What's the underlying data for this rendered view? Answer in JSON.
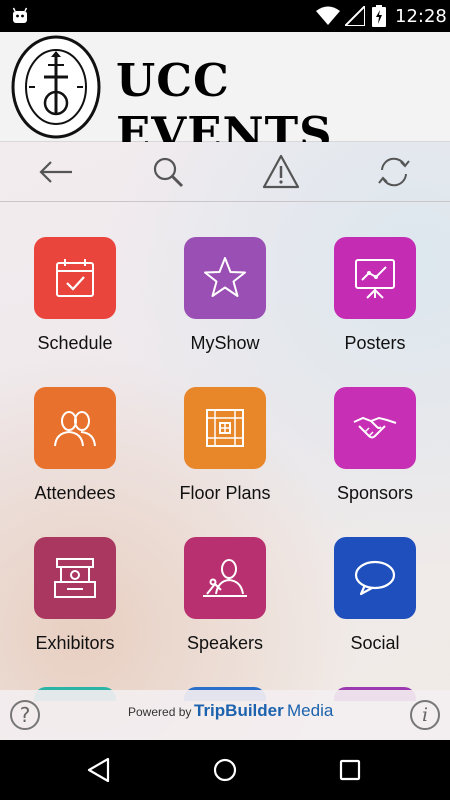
{
  "status_bar": {
    "time": "12:28"
  },
  "header": {
    "title": "UCC EVENTS",
    "logo_text_top": "UNITED CHURCH OF CHRIST",
    "logo_text_bottom": "THAT THEY MAY ALL BE ONE"
  },
  "toolbar": {
    "icons": [
      "back-arrow-icon",
      "search-icon",
      "alert-icon",
      "refresh-icon"
    ]
  },
  "tiles": [
    {
      "label": "Schedule",
      "color": "#e9453c",
      "icon": "calendar-check-icon"
    },
    {
      "label": "MyShow",
      "color": "#9a4fb4",
      "icon": "star-icon"
    },
    {
      "label": "Posters",
      "color": "#c52cb4",
      "icon": "presentation-board-icon"
    },
    {
      "label": "Attendees",
      "color": "#e8712d",
      "icon": "people-icon"
    },
    {
      "label": "Floor Plans",
      "color": "#e8862a",
      "icon": "floor-plan-icon"
    },
    {
      "label": "Sponsors",
      "color": "#c730b4",
      "icon": "handshake-icon"
    },
    {
      "label": "Exhibitors",
      "color": "#a9375f",
      "icon": "exhibitor-booth-icon"
    },
    {
      "label": "Speakers",
      "color": "#b8306f",
      "icon": "speaker-podium-icon"
    },
    {
      "label": "Social",
      "color": "#1f4fbd",
      "icon": "speech-bubble-icon"
    }
  ],
  "partial_tiles": [
    {
      "color": "#2ab4a6"
    },
    {
      "color": "#2a6fc9"
    },
    {
      "color": "#9b3ab0"
    }
  ],
  "footer": {
    "help_label": "?",
    "info_label": "i",
    "powered_by": "Powered by",
    "brand_bold": "TripBuilder",
    "brand_light": "Media"
  },
  "nav_bar": {
    "icons": [
      "back-triangle-icon",
      "home-circle-icon",
      "recents-square-icon"
    ]
  }
}
